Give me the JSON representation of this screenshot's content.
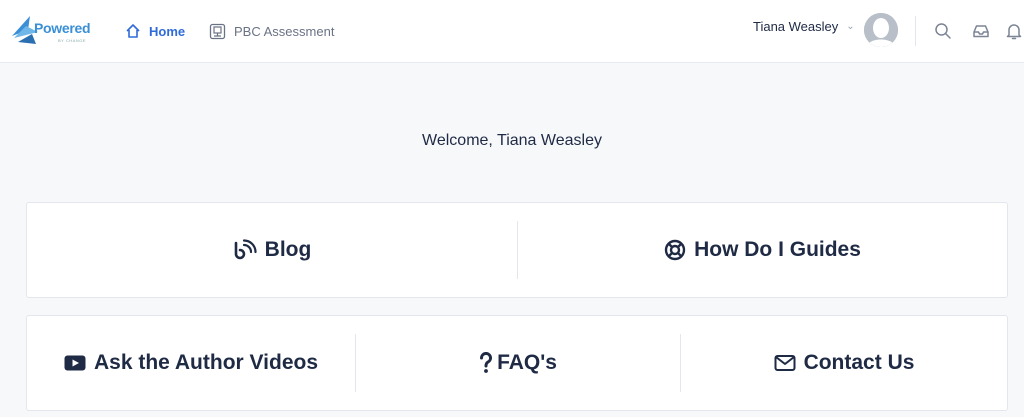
{
  "header": {
    "logo": {
      "text": "Powered",
      "sub": "BY CHANGE"
    },
    "nav": [
      {
        "label": "Home",
        "icon": "home-icon"
      },
      {
        "label": "PBC Assessment",
        "icon": "assessment-icon"
      }
    ],
    "user": {
      "name": "Tiana Weasley"
    },
    "icons": [
      "search-icon",
      "inbox-icon",
      "bell-icon"
    ]
  },
  "welcome": "Welcome, Tiana Weasley",
  "tiles": {
    "row1": [
      {
        "label": "Blog",
        "icon": "rss-icon"
      },
      {
        "label": "How Do I Guides",
        "icon": "lifebuoy-icon"
      }
    ],
    "row2": [
      {
        "label": "Ask the Author Videos",
        "icon": "video-icon"
      },
      {
        "label": "FAQ's",
        "icon": "question-icon"
      },
      {
        "label": "Contact Us",
        "icon": "envelope-icon"
      }
    ]
  },
  "colors": {
    "accent": "#2f6bd9",
    "text": "#1f2a44",
    "muted": "#6a7385",
    "background": "#f7f8fa"
  }
}
